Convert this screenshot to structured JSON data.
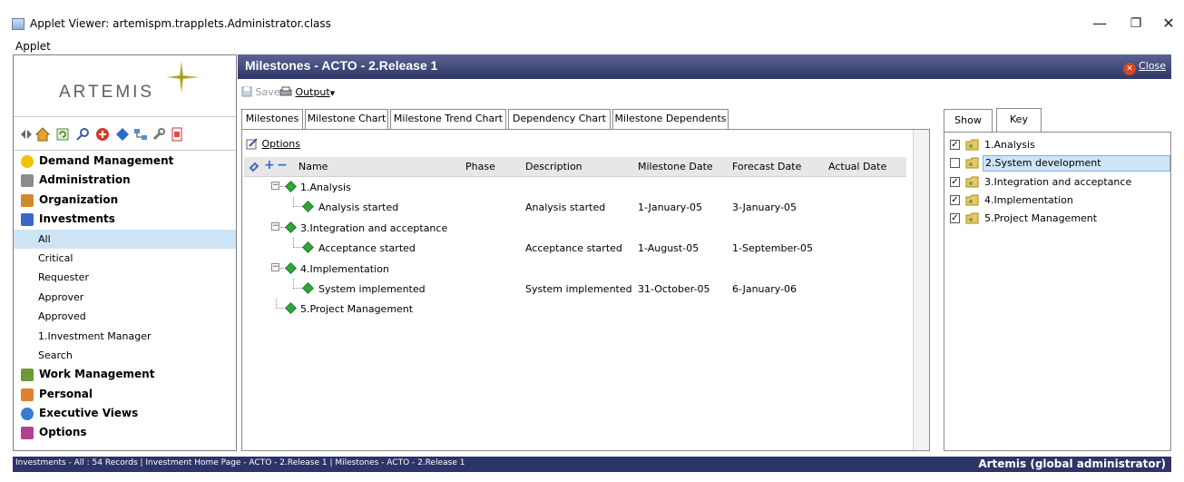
{
  "window": {
    "title": "Applet Viewer: artemispm.trapplets.Administrator.class",
    "menu": "Applet",
    "minimize": "—",
    "maximize": "❐",
    "close": "✕"
  },
  "logo": {
    "text": "ARTEMIS"
  },
  "nav": {
    "items": [
      {
        "label": "Demand Management",
        "icon": "lightbulb-icon",
        "level": "top",
        "color": "#f2c300"
      },
      {
        "label": "Administration",
        "icon": "wrench-icon",
        "level": "top",
        "color": "#8c8c8c"
      },
      {
        "label": "Organization",
        "icon": "people-icon",
        "level": "top",
        "color": "#d08a2a"
      },
      {
        "label": "Investments",
        "icon": "investments-icon",
        "level": "top",
        "color": "#3a67c9"
      },
      {
        "label": "All",
        "level": "sub",
        "selected": true
      },
      {
        "label": "Critical",
        "level": "sub"
      },
      {
        "label": "Requester",
        "level": "sub"
      },
      {
        "label": "Approver",
        "level": "sub"
      },
      {
        "label": "Approved",
        "level": "sub"
      },
      {
        "label": "1.Investment Manager",
        "level": "sub"
      },
      {
        "label": "Search",
        "level": "sub"
      },
      {
        "label": "Work Management",
        "icon": "work-icon",
        "level": "top",
        "color": "#6a9a3a"
      },
      {
        "label": "Personal",
        "icon": "person-icon",
        "level": "top",
        "color": "#e08030"
      },
      {
        "label": "Executive Views",
        "icon": "globe-icon",
        "level": "top",
        "color": "#3a7ad0"
      },
      {
        "label": "Options",
        "icon": "options-icon",
        "level": "top",
        "color": "#b04090"
      }
    ]
  },
  "main": {
    "title": "Milestones - ACTO - 2.Release 1",
    "close_label": "Close",
    "save_label": "Save",
    "output_label": "Output",
    "options_label": "Options"
  },
  "tabs": [
    {
      "label": "Milestones",
      "active": true
    },
    {
      "label": "Milestone Chart"
    },
    {
      "label": "Milestone Trend Chart"
    },
    {
      "label": "Dependency Chart"
    },
    {
      "label": "Milestone Dependents"
    }
  ],
  "grid": {
    "columns": [
      "Name",
      "Phase",
      "Description",
      "Milestone Date",
      "Forecast Date",
      "Actual Date"
    ],
    "rows": [
      {
        "name": "1.Analysis",
        "level": 0,
        "expandable": true,
        "phase": "",
        "description": "",
        "milestone_date": "",
        "forecast_date": "",
        "actual_date": ""
      },
      {
        "name": "Analysis started",
        "level": 1,
        "phase": "",
        "description": "Analysis started",
        "milestone_date": "1-January-05",
        "forecast_date": "3-January-05",
        "actual_date": ""
      },
      {
        "name": "3.Integration and acceptance",
        "level": 0,
        "expandable": true,
        "phase": "",
        "description": "",
        "milestone_date": "",
        "forecast_date": "",
        "actual_date": ""
      },
      {
        "name": "Acceptance started",
        "level": 1,
        "phase": "",
        "description": "Acceptance started",
        "milestone_date": "1-August-05",
        "forecast_date": "1-September-05",
        "actual_date": ""
      },
      {
        "name": "4.Implementation",
        "level": 0,
        "expandable": true,
        "phase": "",
        "description": "",
        "milestone_date": "",
        "forecast_date": "",
        "actual_date": ""
      },
      {
        "name": "System implemented",
        "level": 1,
        "phase": "",
        "description": "System implemented",
        "milestone_date": "31-October-05",
        "forecast_date": "6-January-06",
        "actual_date": ""
      },
      {
        "name": "5.Project Management",
        "level": 0,
        "expandable": false,
        "phase": "",
        "description": "",
        "milestone_date": "",
        "forecast_date": "",
        "actual_date": ""
      }
    ]
  },
  "right_panel": {
    "tabs": [
      "Show",
      "Key"
    ],
    "items": [
      {
        "label": "1.Analysis",
        "checked": true
      },
      {
        "label": "2.System development",
        "checked": false,
        "selected": true
      },
      {
        "label": "3.Integration and acceptance",
        "checked": true
      },
      {
        "label": "4.Implementation",
        "checked": true
      },
      {
        "label": "5.Project Management",
        "checked": true
      }
    ]
  },
  "status": {
    "left": "Investments - All : 54 Records | Investment Home Page - ACTO - 2.Release 1 | Milestones - ACTO - 2.Release 1",
    "right": "Artemis (global administrator)"
  },
  "colors": {
    "header_dark": "#2c3468",
    "selection": "#cde4f7",
    "milestone_green": "#2fa83a"
  }
}
